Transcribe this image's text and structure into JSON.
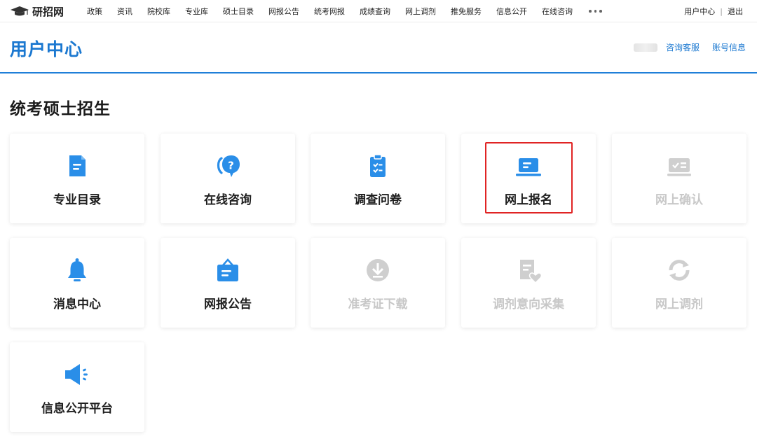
{
  "brand": {
    "name": "研招网"
  },
  "nav": {
    "items": [
      "政策",
      "资讯",
      "院校库",
      "专业库",
      "硕士目录",
      "网报公告",
      "统考网报",
      "成绩查询",
      "网上调剂",
      "推免服务",
      "信息公开",
      "在线咨询"
    ],
    "user_center": "用户中心",
    "separator": "|",
    "logout": "退出"
  },
  "header": {
    "title": "用户中心",
    "consult_service": "咨询客服",
    "account_info": "账号信息"
  },
  "section": {
    "title": "统考硕士招生"
  },
  "cards": [
    {
      "label": "专业目录",
      "icon": "document-icon",
      "enabled": true
    },
    {
      "label": "在线咨询",
      "icon": "question-bubble-icon",
      "enabled": true
    },
    {
      "label": "调查问卷",
      "icon": "clipboard-icon",
      "enabled": true
    },
    {
      "label": "网上报名",
      "icon": "laptop-icon",
      "enabled": true,
      "highlighted": true
    },
    {
      "label": "网上确认",
      "icon": "id-card-check-icon",
      "enabled": false
    },
    {
      "label": "消息中心",
      "icon": "bell-icon",
      "enabled": true
    },
    {
      "label": "网报公告",
      "icon": "announcement-board-icon",
      "enabled": true
    },
    {
      "label": "准考证下载",
      "icon": "download-icon",
      "enabled": false
    },
    {
      "label": "调剂意向采集",
      "icon": "heart-document-icon",
      "enabled": false
    },
    {
      "label": "网上调剂",
      "icon": "refresh-icon",
      "enabled": false
    },
    {
      "label": "信息公开平台",
      "icon": "megaphone-icon",
      "enabled": true
    }
  ],
  "colors": {
    "primary": "#1b78d0",
    "icon_blue": "#2a8ee8",
    "disabled": "#c8c8c8",
    "highlight": "#e02424"
  }
}
